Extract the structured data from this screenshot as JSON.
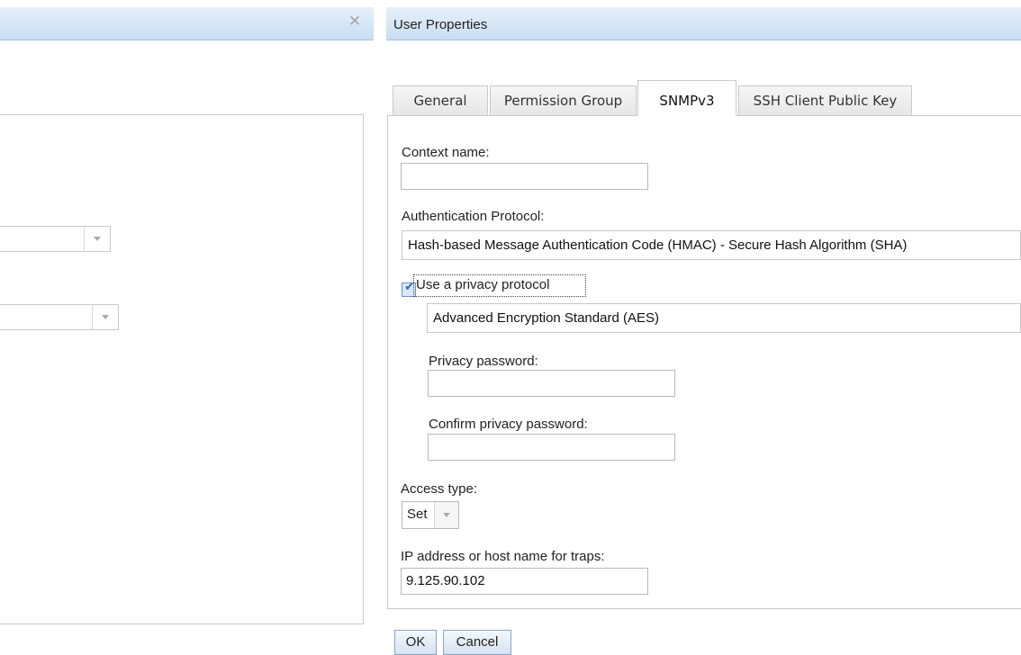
{
  "left_dialog": {
    "close_icon": "×"
  },
  "dialog": {
    "title": "User Properties"
  },
  "tabs": [
    {
      "label": "General",
      "active": false
    },
    {
      "label": "Permission Group",
      "active": false
    },
    {
      "label": "SNMPv3",
      "active": true
    },
    {
      "label": "SSH Client Public Key",
      "active": false
    }
  ],
  "form": {
    "context_name_label": "Context name:",
    "context_name_value": "",
    "auth_protocol_label": "Authentication Protocol:",
    "auth_protocol_value": "Hash-based Message Authentication Code (HMAC) - Secure Hash Algorithm (SHA)",
    "privacy_checkbox_label": "Use a privacy protocol",
    "privacy_checkbox_checked": true,
    "privacy_protocol_value": "Advanced Encryption Standard (AES)",
    "privacy_password_label": "Privacy password:",
    "confirm_privacy_password_label": "Confirm privacy password:",
    "access_type_label": "Access type:",
    "access_type_value": "Set",
    "trap_host_label": "IP address or host name for traps:",
    "trap_host_value": "9.125.90.102"
  },
  "buttons": {
    "ok": "OK",
    "cancel": "Cancel"
  },
  "icons": {
    "checkmark": "✔"
  }
}
